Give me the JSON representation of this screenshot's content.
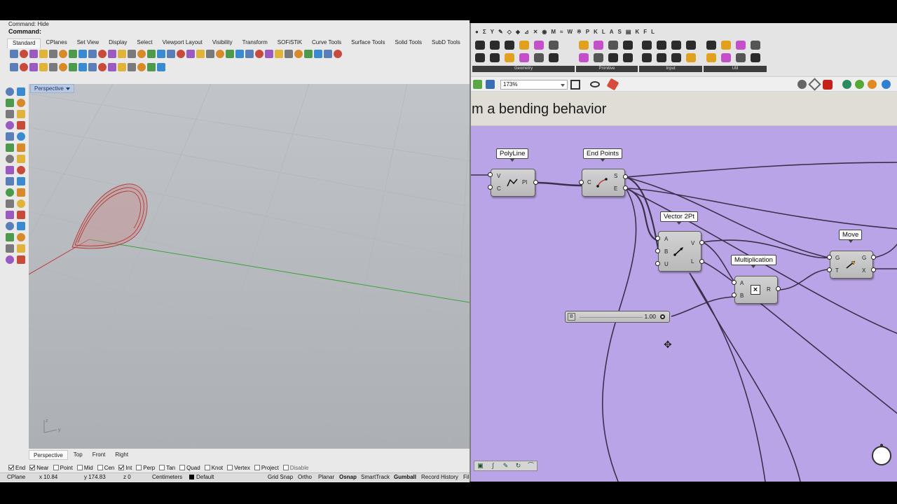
{
  "rhino": {
    "command_history": "Command: Hide",
    "command_prompt": "Command:",
    "tabs": [
      "Standard",
      "CPlanes",
      "Set View",
      "Display",
      "Select",
      "Viewport Layout",
      "Visibility",
      "Transform",
      "SOFiSTiK",
      "Curve Tools",
      "Surface Tools",
      "Solid Tools",
      "SubD Tools"
    ],
    "active_tab": "Standard",
    "viewport_label": "Perspective",
    "view_tabs": [
      "Perspective",
      "Top",
      "Front",
      "Right"
    ],
    "osnaps": [
      {
        "label": "End",
        "checked": true
      },
      {
        "label": "Near",
        "checked": true
      },
      {
        "label": "Point",
        "checked": false
      },
      {
        "label": "Mid",
        "checked": false
      },
      {
        "label": "Cen",
        "checked": false
      },
      {
        "label": "Int",
        "checked": true
      },
      {
        "label": "Perp",
        "checked": false
      },
      {
        "label": "Tan",
        "checked": false
      },
      {
        "label": "Quad",
        "checked": false
      },
      {
        "label": "Knot",
        "checked": false
      },
      {
        "label": "Vertex",
        "checked": false
      },
      {
        "label": "Project",
        "checked": false
      },
      {
        "label": "Disable",
        "checked": false
      }
    ],
    "status": {
      "cplane": "CPlane",
      "x": "x 10.84",
      "y": "y 174.83",
      "z": "z 0",
      "units": "Centimeters",
      "layer": "Default",
      "grid_snap": "Grid Snap",
      "ortho": "Ortho",
      "planar": "Planar",
      "osnap": "Osnap",
      "smarttrack": "SmartTrack",
      "gumball": "Gumball",
      "record_history": "Record History",
      "filter": "Fil"
    }
  },
  "grasshopper": {
    "menu_glyphs": [
      "●",
      "Σ",
      "Y",
      "✎",
      "◇",
      "◆",
      "⊿",
      "✕",
      "◉",
      "M",
      "≈",
      "W",
      "※",
      "P",
      "K",
      "L",
      "A",
      "S",
      "▤",
      "K",
      "F",
      "L"
    ],
    "ribbon_groups": [
      "Geometry",
      "Primitive",
      "Input",
      "Util"
    ],
    "zoom": "173%",
    "canvas_title": "m a bending behavior",
    "components": {
      "polyline": {
        "tag": "PolyLine",
        "inputs": [
          "V",
          "C"
        ],
        "output": "Pl"
      },
      "endpoints": {
        "tag": "End Points",
        "input": "C",
        "outputs": [
          "S",
          "E"
        ]
      },
      "vector2pt": {
        "tag": "Vector 2Pt",
        "inputs": [
          "A",
          "B",
          "U"
        ],
        "outputs": [
          "V",
          "L"
        ]
      },
      "multiplication": {
        "tag": "Multiplication",
        "inputs": [
          "A",
          "B"
        ],
        "output": "R"
      },
      "move": {
        "tag": "Move",
        "inputs": [
          "G",
          "T"
        ],
        "outputs": [
          "G",
          "X"
        ]
      }
    },
    "slider": {
      "grip": "B",
      "value": "1.00"
    },
    "colors": {
      "canvas": "#b9a4e7",
      "wire": "#3b2f4a",
      "curve": "#c0393b",
      "axis_green": "#3aa23a"
    }
  }
}
